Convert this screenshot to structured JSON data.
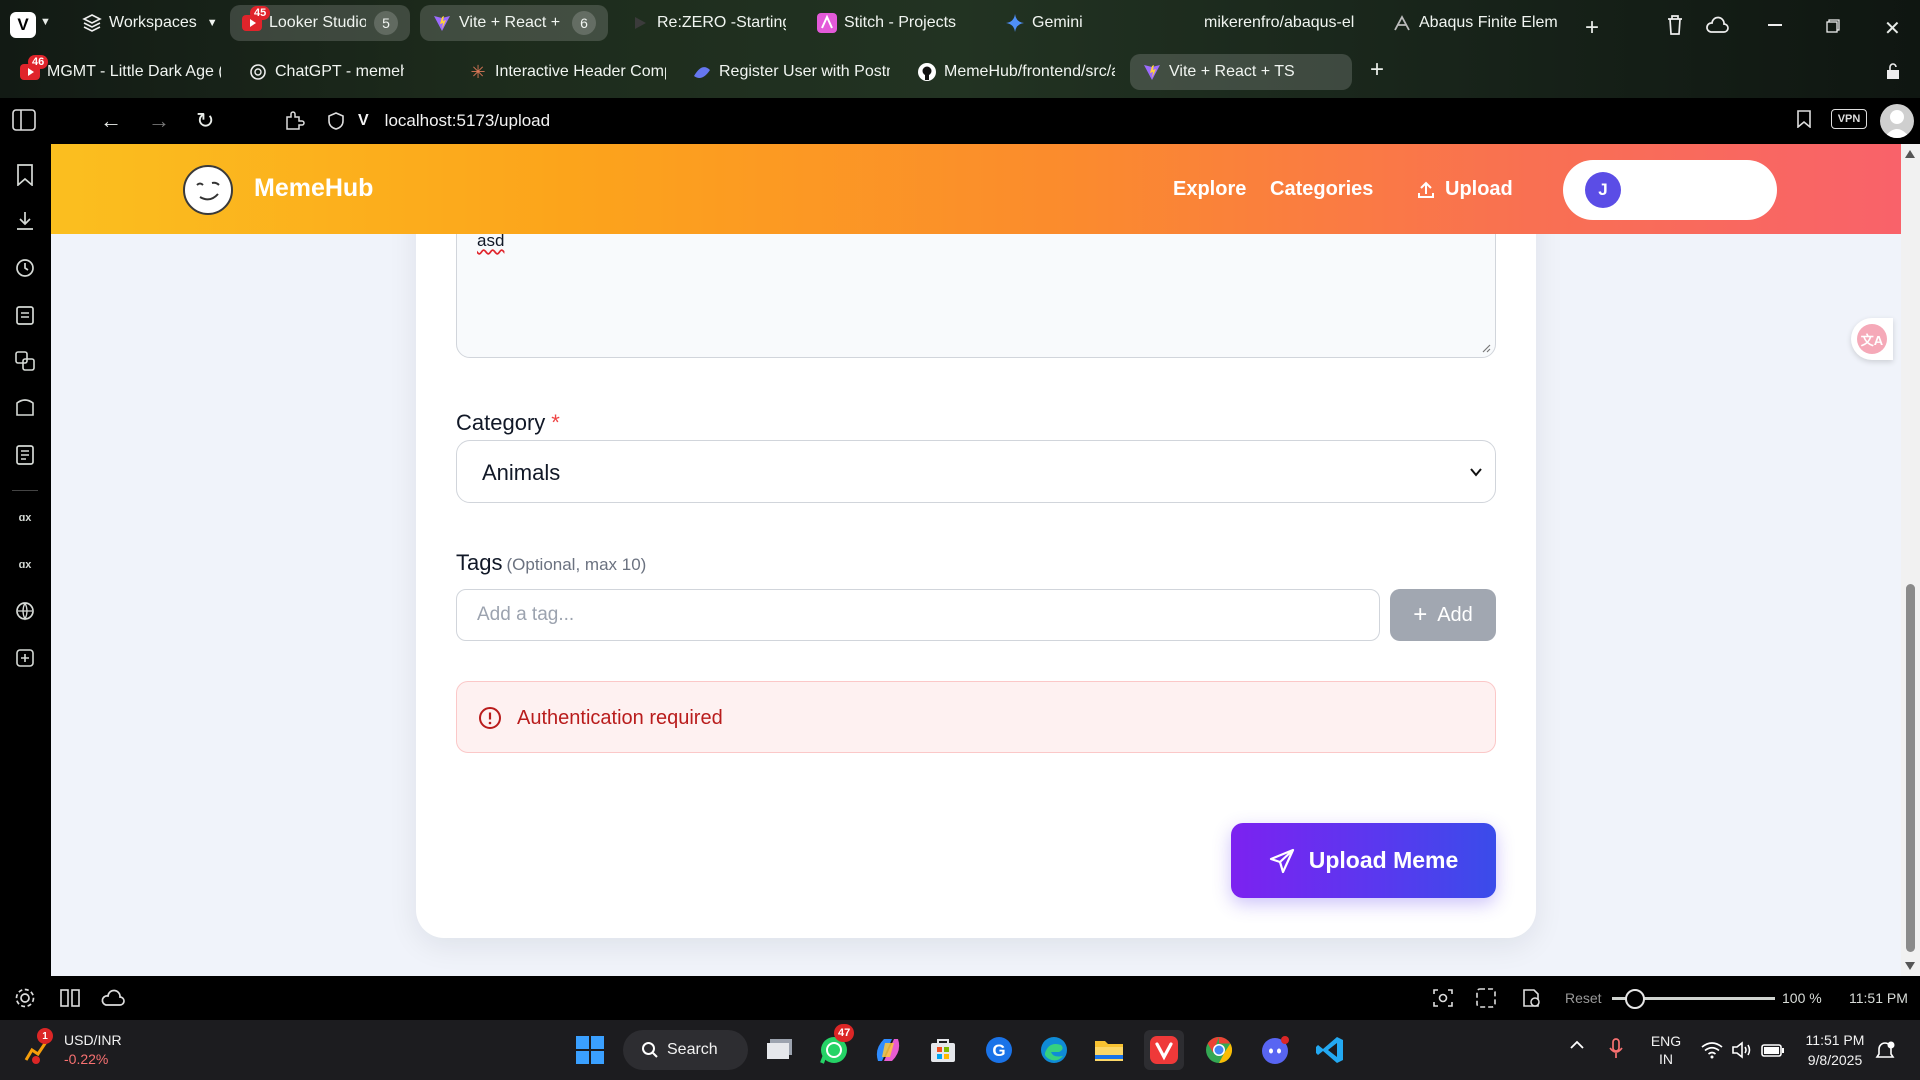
{
  "browser": {
    "workspaces_label": "Workspaces",
    "tabs_row1": [
      {
        "label": "Looker Studio: Qu",
        "badge": "45",
        "count": ""
      },
      {
        "label": "Vite + React + TS",
        "badge": "",
        "count": "6"
      },
      {
        "label": "Re:ZERO -Starting Life",
        "badge": "",
        "count": ""
      },
      {
        "label": "Stitch - Projects",
        "badge": "",
        "count": ""
      },
      {
        "label": "Gemini",
        "badge": "",
        "count": ""
      },
      {
        "label": "mikerenfro/abaqus-el",
        "badge": "",
        "count": ""
      },
      {
        "label": "Abaqus Finite Element",
        "badge": "",
        "count": ""
      }
    ],
    "tab1_count": "5",
    "tabs_row2": [
      {
        "label": "MGMT - Little Dark Age (Of",
        "badge": "46"
      },
      {
        "label": "ChatGPT - memehub",
        "badge": ""
      },
      {
        "label": "Interactive Header Compon",
        "badge": ""
      },
      {
        "label": "Register User with Postman",
        "badge": ""
      },
      {
        "label": "MemeHub/frontend/src/ap",
        "badge": ""
      },
      {
        "label": "Vite + React + TS",
        "badge": ""
      }
    ],
    "url": "localhost:5173/upload",
    "vpn_label": "VPN"
  },
  "site": {
    "brand": "MemeHub",
    "nav": {
      "explore": "Explore",
      "categories": "Categories",
      "upload": "Upload"
    },
    "user_initial": "J"
  },
  "form": {
    "description_value": "asd",
    "category_label": "Category",
    "required_mark": "*",
    "category_value": "Animals",
    "tags_label": "Tags",
    "tags_hint": "(Optional, max 10)",
    "tag_placeholder": "Add a tag...",
    "add_label": "Add",
    "error_message": "Authentication required",
    "submit_label": "Upload Meme"
  },
  "statusbar": {
    "reset_label": "Reset",
    "zoom": "100 %",
    "time": "11:51 PM",
    "zoom_level": 0.14
  },
  "taskbar": {
    "ticker_name": "USD/INR",
    "ticker_change": "-0.22%",
    "ticker_badge": "1",
    "search_label": "Search",
    "whatsapp_badge": "47",
    "lang1": "ENG",
    "lang2": "IN",
    "clock_time": "11:51 PM",
    "clock_date": "9/8/2025"
  },
  "colors": {
    "header_start": "#fbbf1f",
    "header_end": "#f9626a",
    "accent": "#5a38ef",
    "error": "#b91c1c"
  }
}
